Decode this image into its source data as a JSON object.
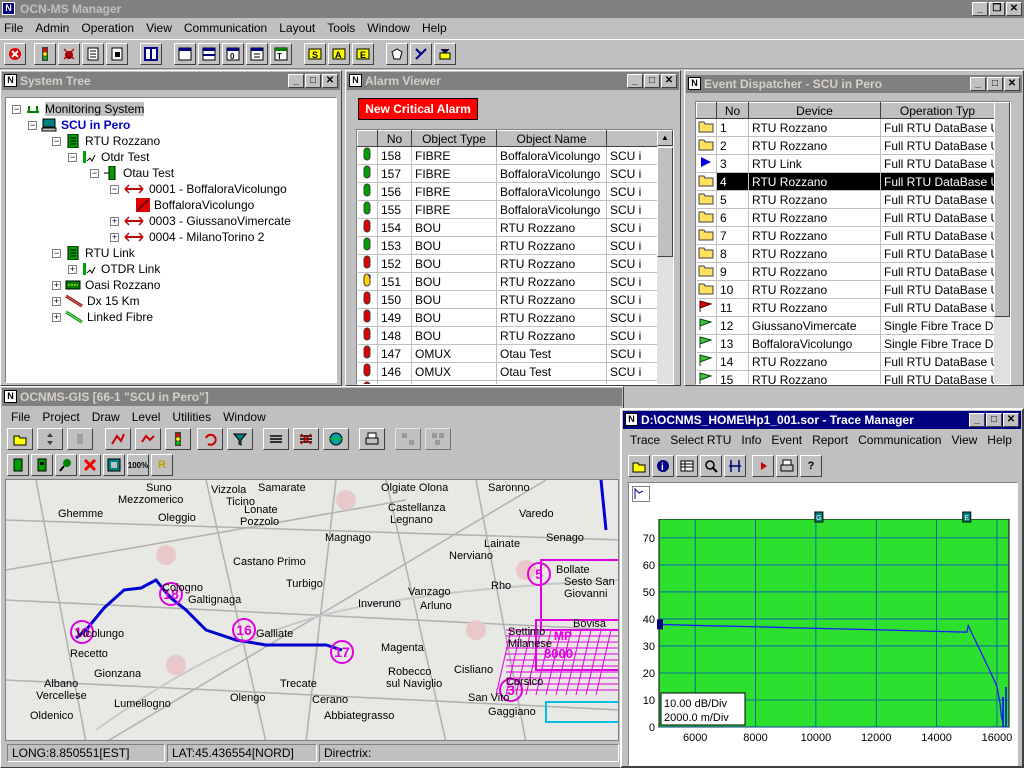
{
  "app": {
    "title": "OCN-MS Manager",
    "menu": [
      "File",
      "Admin",
      "Operation",
      "View",
      "Communication",
      "Layout",
      "Tools",
      "Window",
      "Help"
    ]
  },
  "system_tree": {
    "title": "System Tree",
    "items": [
      {
        "label": "Monitoring System",
        "level": 0
      },
      {
        "label": "SCU in Pero",
        "level": 1
      },
      {
        "label": "RTU Rozzano",
        "level": 2
      },
      {
        "label": "Otdr Test",
        "level": 3
      },
      {
        "label": "Otau Test",
        "level": 4
      },
      {
        "label": "0001 - BoffaloraVicolungo",
        "level": 5
      },
      {
        "label": "BoffaloraVicolungo",
        "level": 6
      },
      {
        "label": "0003 - GiussanoVimercate",
        "level": 5
      },
      {
        "label": "0004 - MilanoTorino 2",
        "level": 5
      },
      {
        "label": "RTU Link",
        "level": 2
      },
      {
        "label": "OTDR Link",
        "level": 3
      },
      {
        "label": "Oasi Rozzano",
        "level": 2
      },
      {
        "label": "Dx 15 Km",
        "level": 2
      },
      {
        "label": "Linked Fibre",
        "level": 2
      }
    ]
  },
  "alarm_viewer": {
    "title": "Alarm Viewer",
    "alert_label": "New Critical Alarm",
    "columns": [
      "No",
      "Object Type",
      "Object Name",
      ""
    ],
    "rows": [
      {
        "status": "green",
        "no": "158",
        "type": "FIBRE",
        "name": "BoffaloraVicolungo",
        "scu": "SCU i"
      },
      {
        "status": "green",
        "no": "157",
        "type": "FIBRE",
        "name": "BoffaloraVicolungo",
        "scu": "SCU i"
      },
      {
        "status": "green",
        "no": "156",
        "type": "FIBRE",
        "name": "BoffaloraVicolungo",
        "scu": "SCU i"
      },
      {
        "status": "green",
        "no": "155",
        "type": "FIBRE",
        "name": "BoffaloraVicolungo",
        "scu": "SCU i"
      },
      {
        "status": "red",
        "no": "154",
        "type": "BOU",
        "name": "RTU Rozzano",
        "scu": "SCU i"
      },
      {
        "status": "green",
        "no": "153",
        "type": "BOU",
        "name": "RTU Rozzano",
        "scu": "SCU i"
      },
      {
        "status": "red",
        "no": "152",
        "type": "BOU",
        "name": "RTU Rozzano",
        "scu": "SCU i"
      },
      {
        "status": "yellow",
        "no": "151",
        "type": "BOU",
        "name": "RTU Rozzano",
        "scu": "SCU i"
      },
      {
        "status": "red",
        "no": "150",
        "type": "BOU",
        "name": "RTU Rozzano",
        "scu": "SCU i"
      },
      {
        "status": "red",
        "no": "149",
        "type": "BOU",
        "name": "RTU Rozzano",
        "scu": "SCU i"
      },
      {
        "status": "red",
        "no": "148",
        "type": "BOU",
        "name": "RTU Rozzano",
        "scu": "SCU i"
      },
      {
        "status": "red",
        "no": "147",
        "type": "OMUX",
        "name": "Otau Test",
        "scu": "SCU i"
      },
      {
        "status": "red",
        "no": "146",
        "type": "OMUX",
        "name": "Otau Test",
        "scu": "SCU i"
      },
      {
        "status": "red",
        "no": "145",
        "type": "FIBRE",
        "name": "BoffaloraVicolungo",
        "scu": "SCU i"
      }
    ]
  },
  "event_dispatcher": {
    "title": "Event Dispatcher - SCU in Pero",
    "columns": [
      "",
      "No",
      "Device",
      "Operation Typ"
    ],
    "rows": [
      {
        "icon": "folder",
        "no": "1",
        "device": "RTU Rozzano",
        "op": "Full RTU DataBase Up"
      },
      {
        "icon": "folder",
        "no": "2",
        "device": "RTU Rozzano",
        "op": "Full RTU DataBase Up"
      },
      {
        "icon": "play",
        "no": "3",
        "device": "RTU Link",
        "op": "Full RTU DataBase Up"
      },
      {
        "icon": "folder",
        "no": "4",
        "device": "RTU Rozzano",
        "op": "Full RTU DataBase Up",
        "selected": true
      },
      {
        "icon": "folder",
        "no": "5",
        "device": "RTU Rozzano",
        "op": "Full RTU DataBase Up"
      },
      {
        "icon": "folder",
        "no": "6",
        "device": "RTU Rozzano",
        "op": "Full RTU DataBase Up"
      },
      {
        "icon": "folder",
        "no": "7",
        "device": "RTU Rozzano",
        "op": "Full RTU DataBase Up"
      },
      {
        "icon": "folder",
        "no": "8",
        "device": "RTU Rozzano",
        "op": "Full RTU DataBase Up"
      },
      {
        "icon": "folder",
        "no": "9",
        "device": "RTU Rozzano",
        "op": "Full RTU DataBase Up"
      },
      {
        "icon": "folder",
        "no": "10",
        "device": "RTU Rozzano",
        "op": "Full RTU DataBase Up"
      },
      {
        "icon": "flag-red",
        "no": "11",
        "device": "RTU Rozzano",
        "op": "Full RTU DataBase Up"
      },
      {
        "icon": "flag-green",
        "no": "12",
        "device": "GiussanoVimercate",
        "op": "Single Fibre Trace Dow"
      },
      {
        "icon": "flag-green",
        "no": "13",
        "device": "BoffaloraVicolungo",
        "op": "Single Fibre Trace Dow"
      },
      {
        "icon": "flag-green",
        "no": "14",
        "device": "RTU Rozzano",
        "op": "Full RTU DataBase Up"
      },
      {
        "icon": "flag-green",
        "no": "15",
        "device": "RTU Rozzano",
        "op": "Full RTU DataBase Up"
      },
      {
        "icon": "flag-green",
        "no": "16",
        "device": "BoffaloraVicolungo",
        "op": "Single Fibre Trace Dow"
      }
    ]
  },
  "gis": {
    "title": "OCNMS-GIS [66-1 \"SCU in Pero\"]",
    "menu": [
      "File",
      "Project",
      "Draw",
      "Level",
      "Utilities",
      "Window"
    ],
    "status": {
      "long": "LONG:8.850551[EST]",
      "lat": "LAT:45.436554[NORD]",
      "directrix": "Directrix:"
    },
    "places": [
      "Suno",
      "Mezzomerico",
      "Vizzola",
      "Ticino",
      "Samarate",
      "Olgiate Olona",
      "Saronno",
      "Ghemme",
      "Oleggio",
      "Lonate",
      "Pozzolo",
      "Castellanza",
      "Legnano",
      "Varedo",
      "Magnago",
      "Lainate",
      "Senago",
      "Castano Primo",
      "Nerviano",
      "Turbigo",
      "Bollate",
      "Sesto San",
      "Giovanni",
      "Cologno",
      "Galtignaga",
      "Vanzago",
      "Rho",
      "Inveruno",
      "Arluno",
      "Vicolungo",
      "Galliate",
      "Bovisa",
      "Settimo",
      "Milanese",
      "Recetto",
      "Magenta",
      "Albano",
      "Vercellese",
      "Gionzana",
      "Trecate",
      "Robecco",
      "sul Naviglio",
      "Cisliano",
      "Corsico",
      "Lumellogno",
      "Olengo",
      "Cerano",
      "San Vito",
      "Oldenico",
      "Abbiategrasso",
      "Gaggiano"
    ],
    "nodes": [
      "10",
      "18",
      "16",
      "17",
      "5",
      "3"
    ],
    "mp_label": "MP",
    "mp_value": "8000"
  },
  "trace": {
    "title": "D:\\OCNMS_HOME\\Hp1_001.sor - Trace Manager",
    "menu": [
      "Trace",
      "Select RTU",
      "Info",
      "Event",
      "Report",
      "Communication",
      "View",
      "Help"
    ],
    "scale": [
      "10.00 dB/Div",
      "2000.0 m/Div"
    ],
    "markers": [
      "G",
      "E"
    ]
  },
  "chart_data": {
    "type": "line",
    "xlim": [
      4800,
      16400
    ],
    "ylim": [
      0,
      77
    ],
    "xticks": [
      "6000",
      "8000",
      "10000",
      "12000",
      "14000",
      "16000"
    ],
    "yticks": [
      "70",
      "60",
      "50",
      "40",
      "30",
      "20",
      "10",
      "0"
    ],
    "series": [
      {
        "x": [
          4800,
          6000,
          8000,
          10000,
          12000,
          14000,
          15000,
          15050,
          15200,
          15500,
          15800,
          16000,
          16100,
          16150,
          16200
        ],
        "y": [
          38,
          37.6,
          37.1,
          36.5,
          36,
          35.4,
          35.1,
          37.5,
          34,
          27,
          20,
          15,
          9,
          4,
          2
        ]
      }
    ],
    "background": "#2ee02e",
    "grid_color": "#0050c0",
    "line_color": "#1a1aff"
  }
}
